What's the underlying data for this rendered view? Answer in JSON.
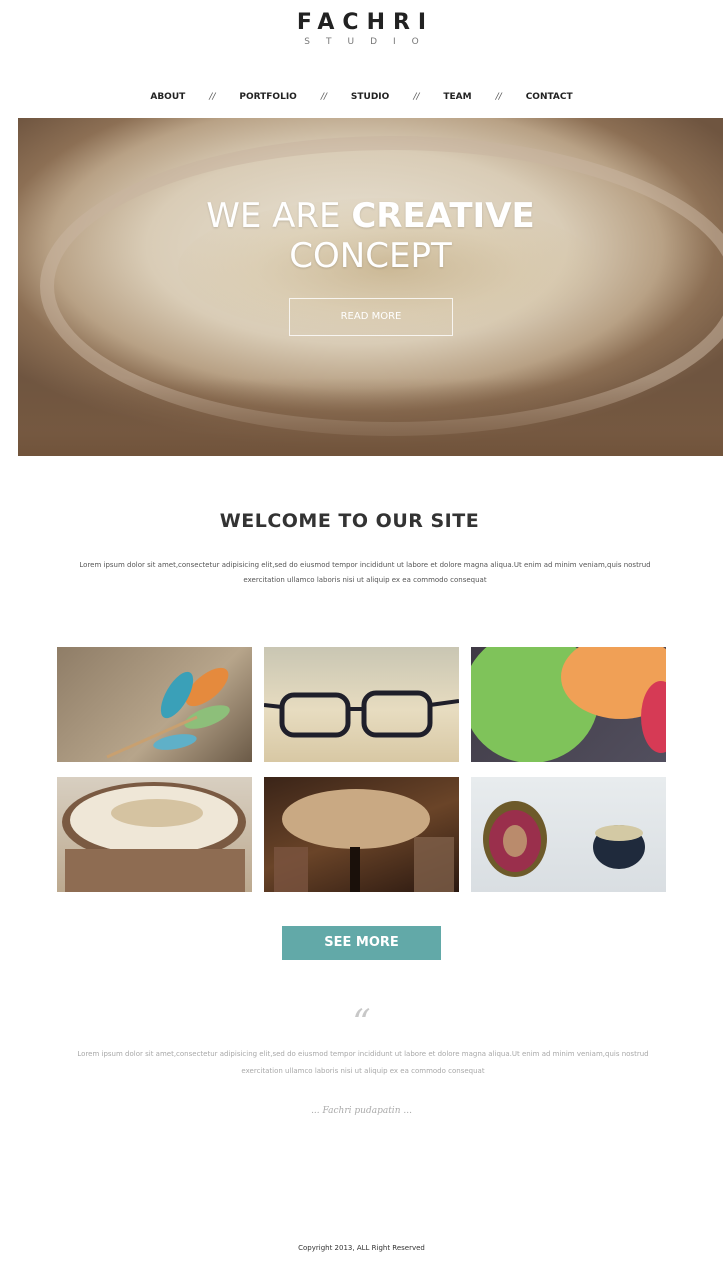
{
  "logo": {
    "main": "FACHRI",
    "sub": "STUDIO"
  },
  "nav": {
    "items": [
      {
        "label": "ABOUT"
      },
      {
        "label": "PORTFOLIO"
      },
      {
        "label": "STUDIO"
      },
      {
        "label": "TEAM"
      },
      {
        "label": "CONTACT"
      }
    ],
    "separator": "//"
  },
  "hero": {
    "title_light": "WE ARE",
    "title_bold": "CREATIVE",
    "title_line2": "CONCEPT",
    "button": "READ MORE"
  },
  "welcome": {
    "heading": "WELCOME TO OUR SITE",
    "text": "Lorem ipsum dolor sit amet,consectetur adipisicing elit,sed do eiusmod tempor incididunt ut labore et dolore magna aliqua.Ut enim ad minim veniam,quis nostrud exercitation ullamco laboris nisi ut aliquip ex ea commodo consequat"
  },
  "gallery": {
    "tiles": [
      {
        "subject": "feather"
      },
      {
        "subject": "glasses"
      },
      {
        "subject": "balloons"
      },
      {
        "subject": "coffee"
      },
      {
        "subject": "cafe-table"
      },
      {
        "subject": "fig"
      }
    ]
  },
  "see_more": "SEE MORE",
  "testimonial": {
    "mark": "“",
    "text": "Lorem ipsum dolor sit amet,consectetur adipisicing elit,sed do eiusmod tempor incididunt ut labore et dolore magna aliqua.Ut enim ad minim veniam,quis nostrud exercitation ullamco laboris nisi ut aliquip ex ea commodo consequat",
    "author": "... Fachri pudapatin ..."
  },
  "footer": {
    "copyright": "Copyright 2013, ALL Right Reserved"
  },
  "colors": {
    "accent": "#62a9a8",
    "text_dark": "#333333"
  }
}
